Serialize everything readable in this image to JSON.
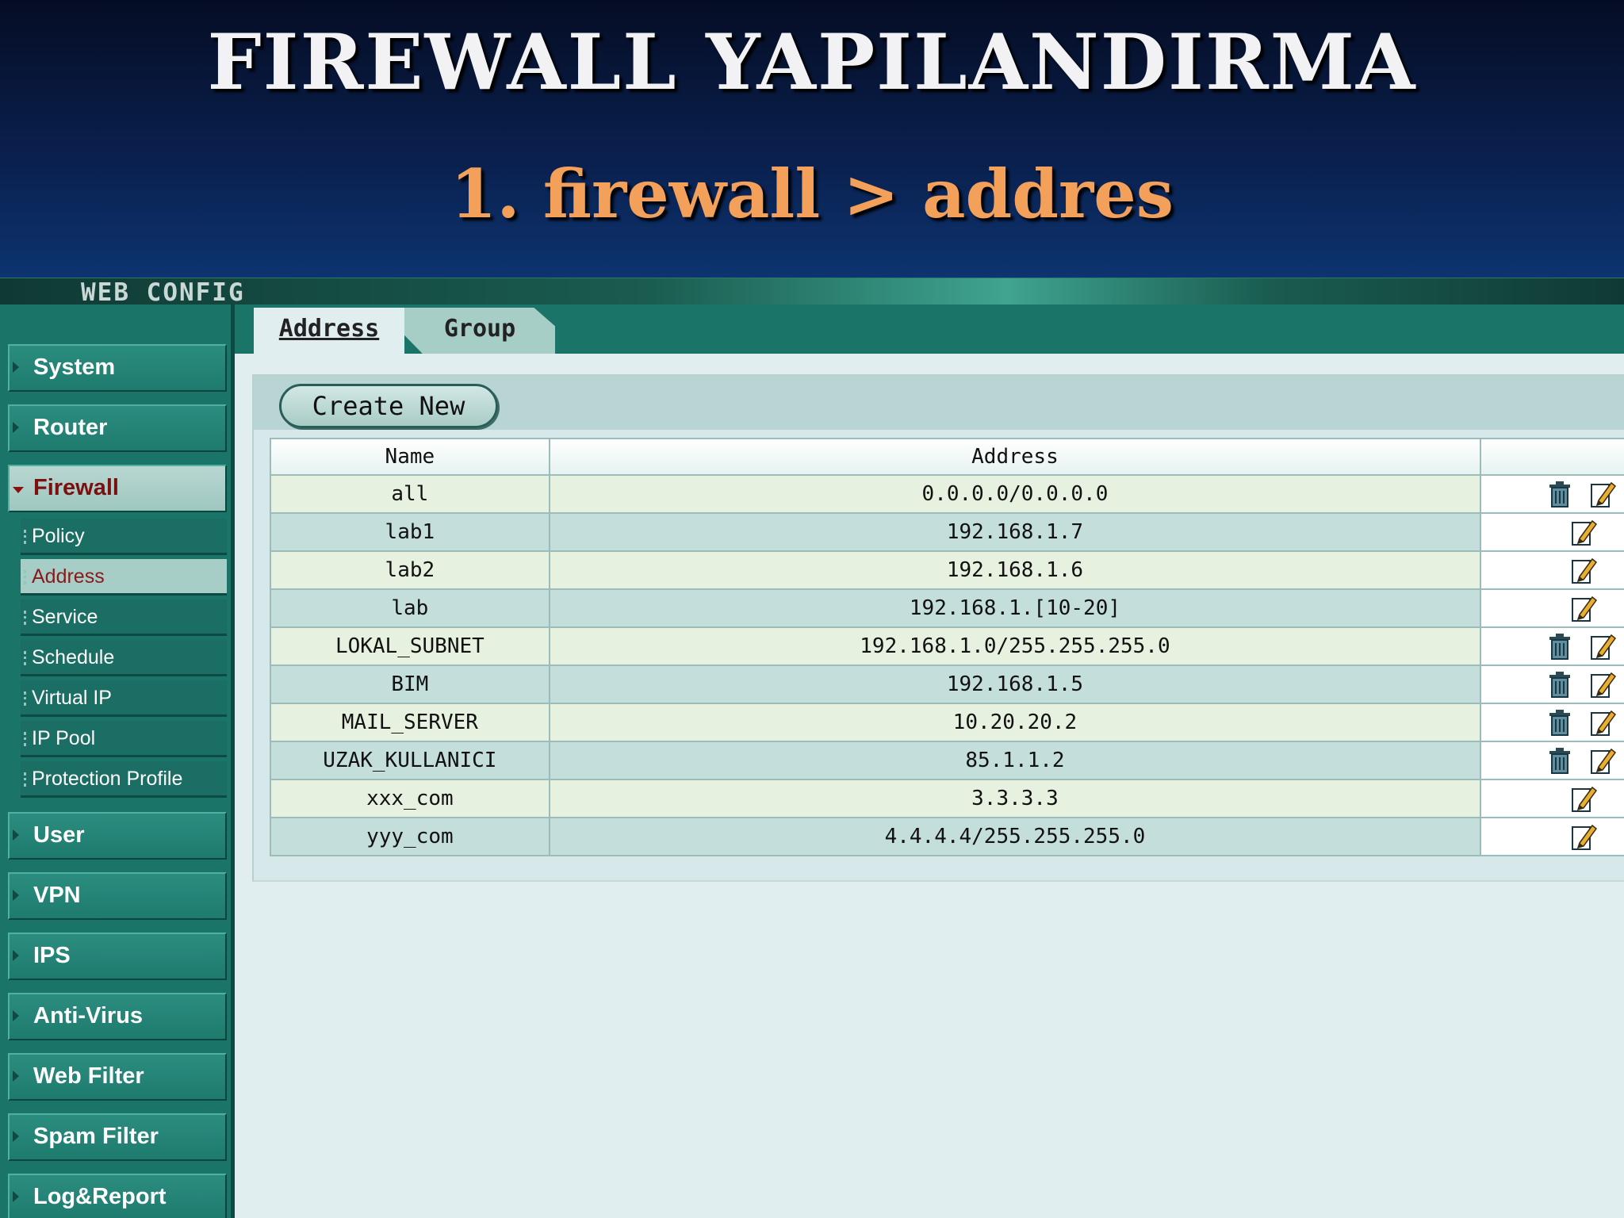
{
  "slide": {
    "title": "FIREWALL YAPILANDIRMA",
    "subtitle": "1. firewall > addres"
  },
  "banner": {
    "text": "WEB CONFIG"
  },
  "sidebar": {
    "items": [
      {
        "label": "System"
      },
      {
        "label": "Router"
      },
      {
        "label": "Firewall"
      },
      {
        "label": "User"
      },
      {
        "label": "VPN"
      },
      {
        "label": "IPS"
      },
      {
        "label": "Anti-Virus"
      },
      {
        "label": "Web Filter"
      },
      {
        "label": "Spam Filter"
      },
      {
        "label": "Log&Report"
      }
    ],
    "firewall_subitems": [
      {
        "label": "Policy"
      },
      {
        "label": "Address"
      },
      {
        "label": "Service"
      },
      {
        "label": "Schedule"
      },
      {
        "label": "Virtual IP"
      },
      {
        "label": "IP Pool"
      },
      {
        "label": "Protection Profile"
      }
    ]
  },
  "tabs": [
    {
      "label": "Address"
    },
    {
      "label": "Group"
    }
  ],
  "toolbar": {
    "create_label": "Create New"
  },
  "table": {
    "headers": [
      "Name",
      "Address",
      ""
    ],
    "rows": [
      {
        "name": "all",
        "address": "0.0.0.0/0.0.0.0",
        "deletable": true
      },
      {
        "name": "lab1",
        "address": "192.168.1.7",
        "deletable": false
      },
      {
        "name": "lab2",
        "address": "192.168.1.6",
        "deletable": false
      },
      {
        "name": "lab",
        "address": "192.168.1.[10-20]",
        "deletable": false
      },
      {
        "name": "LOKAL_SUBNET",
        "address": "192.168.1.0/255.255.255.0",
        "deletable": true
      },
      {
        "name": "BIM",
        "address": "192.168.1.5",
        "deletable": true
      },
      {
        "name": "MAIL_SERVER",
        "address": "10.20.20.2",
        "deletable": true
      },
      {
        "name": "UZAK_KULLANICI",
        "address": "85.1.1.2",
        "deletable": true
      },
      {
        "name": "xxx_com",
        "address": "3.3.3.3",
        "deletable": false
      },
      {
        "name": "yyy_com",
        "address": "4.4.4.4/255.255.255.0",
        "deletable": false
      }
    ]
  },
  "icons": {
    "delete": "trash-icon",
    "edit": "pencil-edit-icon"
  }
}
